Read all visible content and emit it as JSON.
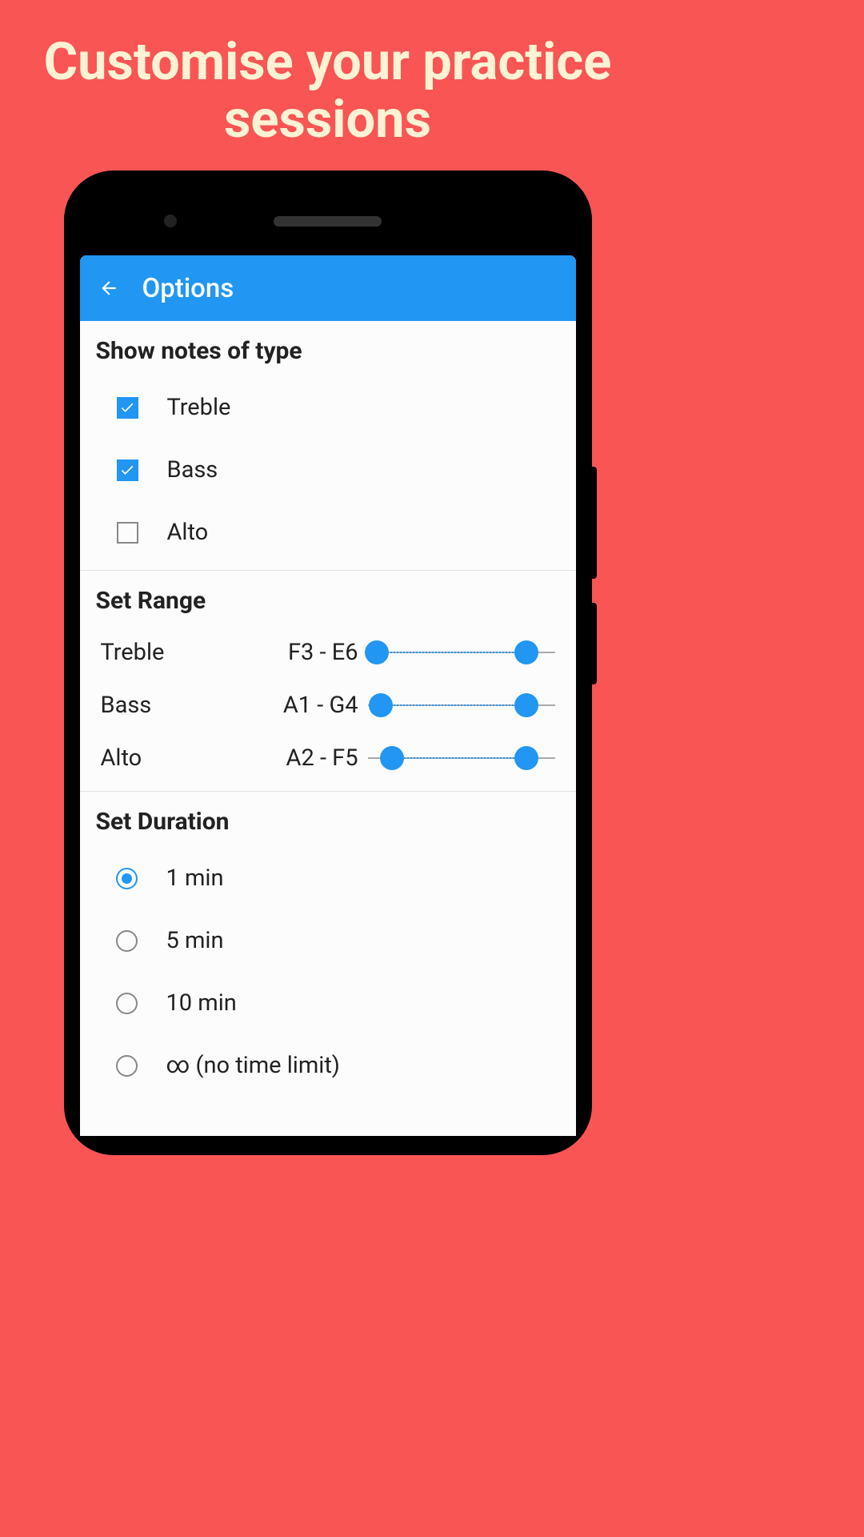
{
  "promo": {
    "headline": "Customise your practice sessions"
  },
  "appbar": {
    "title": "Options"
  },
  "sections": {
    "notesType": {
      "title": "Show notes of type",
      "items": [
        {
          "label": "Treble",
          "checked": true
        },
        {
          "label": "Bass",
          "checked": true
        },
        {
          "label": "Alto",
          "checked": false
        }
      ]
    },
    "range": {
      "title": "Set Range",
      "items": [
        {
          "name": "Treble",
          "value": "F3 - E6",
          "lo": 5,
          "hi": 85
        },
        {
          "name": "Bass",
          "value": "A1 - G4",
          "lo": 7,
          "hi": 85
        },
        {
          "name": "Alto",
          "value": "A2 - F5",
          "lo": 13,
          "hi": 85
        }
      ]
    },
    "duration": {
      "title": "Set Duration",
      "items": [
        {
          "label": "1 min",
          "selected": true
        },
        {
          "label": "5 min",
          "selected": false
        },
        {
          "label": "10 min",
          "selected": false
        },
        {
          "label": "∞ (no time limit)",
          "selected": false
        }
      ]
    }
  }
}
